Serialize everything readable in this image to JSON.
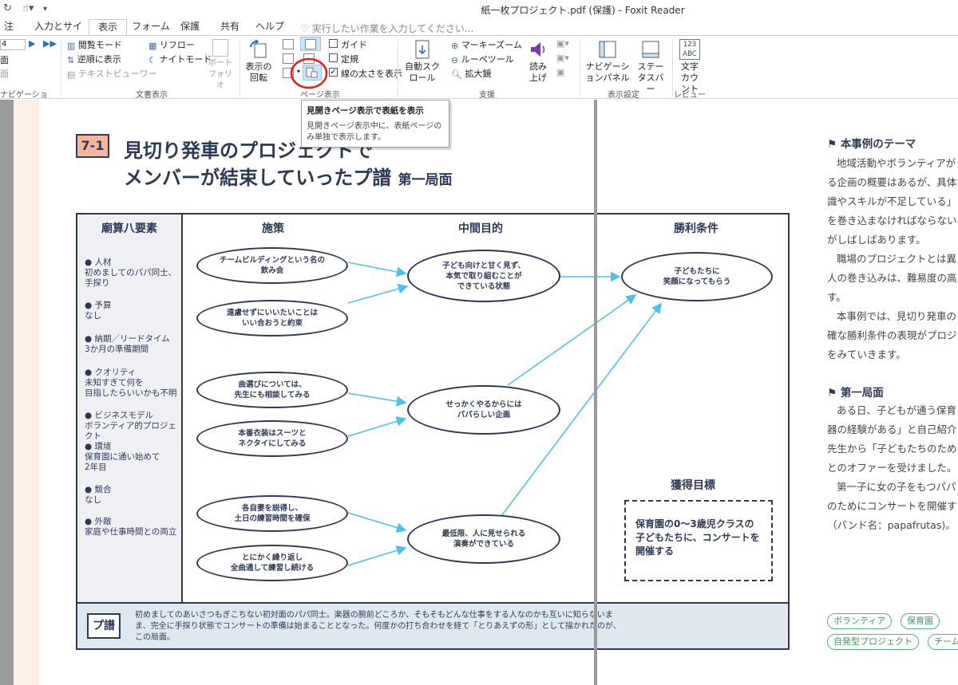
{
  "window": {
    "title": "紙一枚プロジェクト.pdf (保護) - Foxit Reader"
  },
  "tabs": [
    "注釈",
    "入力とサイン",
    "表示",
    "フォーム",
    "保護",
    "共有",
    "ヘルプ"
  ],
  "tellme": "実行したい作業を入力してください...",
  "ribbon": {
    "nav": {
      "page_value": "4",
      "row2": "面",
      "row3": "面",
      "group": "ナビゲーション"
    },
    "doc_view": {
      "reading_mode": "閲覧モード",
      "reverse_view": "逆順に表示",
      "text_viewer": "テキストビューワー",
      "reflow": "リフロー",
      "night_mode": "ナイトモード",
      "portfolio": "ポートフォリオ",
      "group": "文書表示"
    },
    "page_view": {
      "rotate": "表示の回転",
      "guide": "ガイド",
      "ruler": "定規",
      "line_width": "線の太さを表示",
      "group": "ページ表示"
    },
    "assist": {
      "auto_scroll": "自動スクロール",
      "marquee_zoom": "マーキーズーム",
      "loupe": "ルーペツール",
      "magnifier": "拡大鏡",
      "read_aloud": "読み上げ",
      "group": "支援"
    },
    "view_settings": {
      "nav_panel": "ナビゲーションパネル",
      "status_bar": "ステータスバー",
      "group": "表示設定"
    },
    "review": {
      "icon_text": "123 ABC",
      "char_count": "文字カウント",
      "group": "レビュー"
    }
  },
  "tooltip": {
    "title": "見開きページ表示で表紙を表示",
    "body": "見開きページ表示中に、表紙ページのみ単独で表示します。"
  },
  "doc": {
    "chapter_no": "7-1",
    "title_line1": "見切り発車のプロジェクトで",
    "title_line2": "メンバーが結束していったプ譜",
    "title_sub": "第一局面",
    "col_headers": [
      "廟算八要素",
      "施策",
      "中間目的",
      "勝利条件"
    ],
    "elements": [
      "● 人材\n初めましてのパパ同士、\n手探り",
      "● 予算\nなし",
      "● 納期／リードタイム\n3か月の準備期間",
      "● クオリティ\n未知すぎて何を\n目指したらいいかも不明",
      "● ビジネスモデル\nボランティア的プロジェクト",
      "● 環境\n保育園に通い始めて\n2年目",
      "● 競合\nなし",
      "● 外敵\n家庭や仕事時間との両立"
    ],
    "measures": [
      "チームビルディングという名の\n飲み会",
      "遠慮せずにいいたいことは\nいい合おうと約束",
      "曲選びについては、\n先生にも相談してみる",
      "本番衣装はスーツと\nネクタイにしてみる",
      "各自妻を説得し、\n土日の練習時間を確保",
      "とにかく繰り返し\n全曲通して練習し続ける"
    ],
    "mid_goals": [
      "子ども向けと甘く見ず、\n本気で取り組むことが\nできている状態",
      "せっかくやるからには\nパパらしい企画",
      "最低限、人に見せられる\n演奏ができている"
    ],
    "win_condition": "子どもたちに\n笑顔になってもらう",
    "goal_header": "獲得目標",
    "goal_text": "保育園の0〜3歳児クラスの子どもたちに、コンサートを開催する",
    "footer_icon": "プ譜",
    "footer_text": "初めましてのあいさつもぎこちない初対面のパパ同士。楽器の腕前どころか、そもそもどんな仕事をする人なのかも互いに知らないまま、完全に手探り状態でコンサートの準備は始まることとなった。何度かの打ち合わせを経て「とりあえずの形」として描かれたのが、この局面。"
  },
  "right_page": {
    "h1": "本事例のテーマ",
    "p1": [
      "地域活動やボランティアが",
      "る企画の概要はあるが、具体",
      "識やスキルが不足している」",
      "を巻き込まなければならない",
      "がしばしばあります。",
      "職場のプロジェクトとは異",
      "人の巻き込みは、難易度の高",
      "す。",
      "本事例では、見切り発車の",
      "確な勝利条件の表現がプロジ",
      "をみていきます。"
    ],
    "h2": "第一局面",
    "p2": [
      "ある日、子どもが通う保育",
      "器の経験がある」と自己紹介",
      "先生から「子どもたちのため",
      "とのオファーを受けました。",
      "第一子に女の子をもつパパ",
      "のためにコンサートを開催す",
      "（バンド名：papafrutas)。"
    ],
    "tags": [
      "ボランティア",
      "保育園",
      "自発型プロジェクト",
      "チーム"
    ]
  },
  "colors": {
    "navy": "#2d3a57",
    "arrow": "#4fc0e8",
    "badge": "#f5b59a",
    "tag": "#5bb37a",
    "highlight": "#e02020"
  }
}
